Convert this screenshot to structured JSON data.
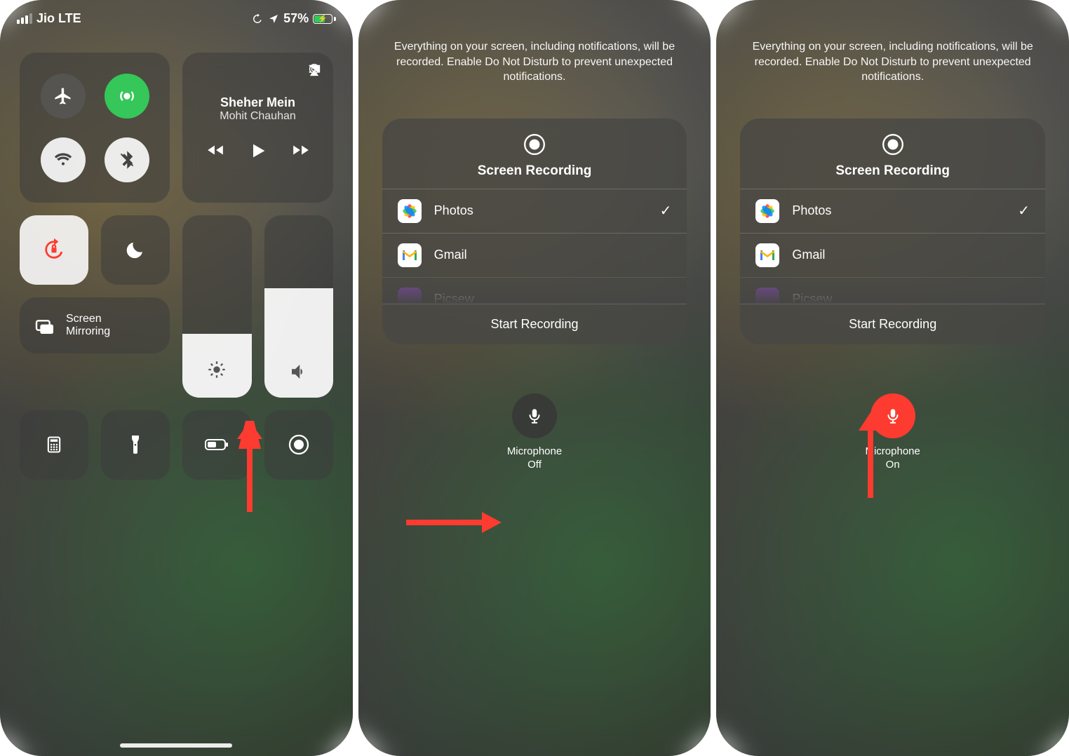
{
  "status": {
    "carrier": "Jio LTE",
    "battery_pct": "57%"
  },
  "media": {
    "title": "Sheher Mein",
    "artist": "Mohit Chauhan"
  },
  "mirroring_label": "Screen\nMirroring",
  "recording_panel": {
    "info": "Everything on your screen, including notifications, will be recorded. Enable Do Not Disturb to prevent unexpected notifications.",
    "title": "Screen Recording",
    "apps": [
      {
        "name": "Photos",
        "selected": true
      },
      {
        "name": "Gmail",
        "selected": false
      },
      {
        "name": "Picsew",
        "selected": false
      }
    ],
    "start": "Start Recording"
  },
  "mic": {
    "label": "Microphone",
    "off": "Off",
    "on": "On"
  }
}
